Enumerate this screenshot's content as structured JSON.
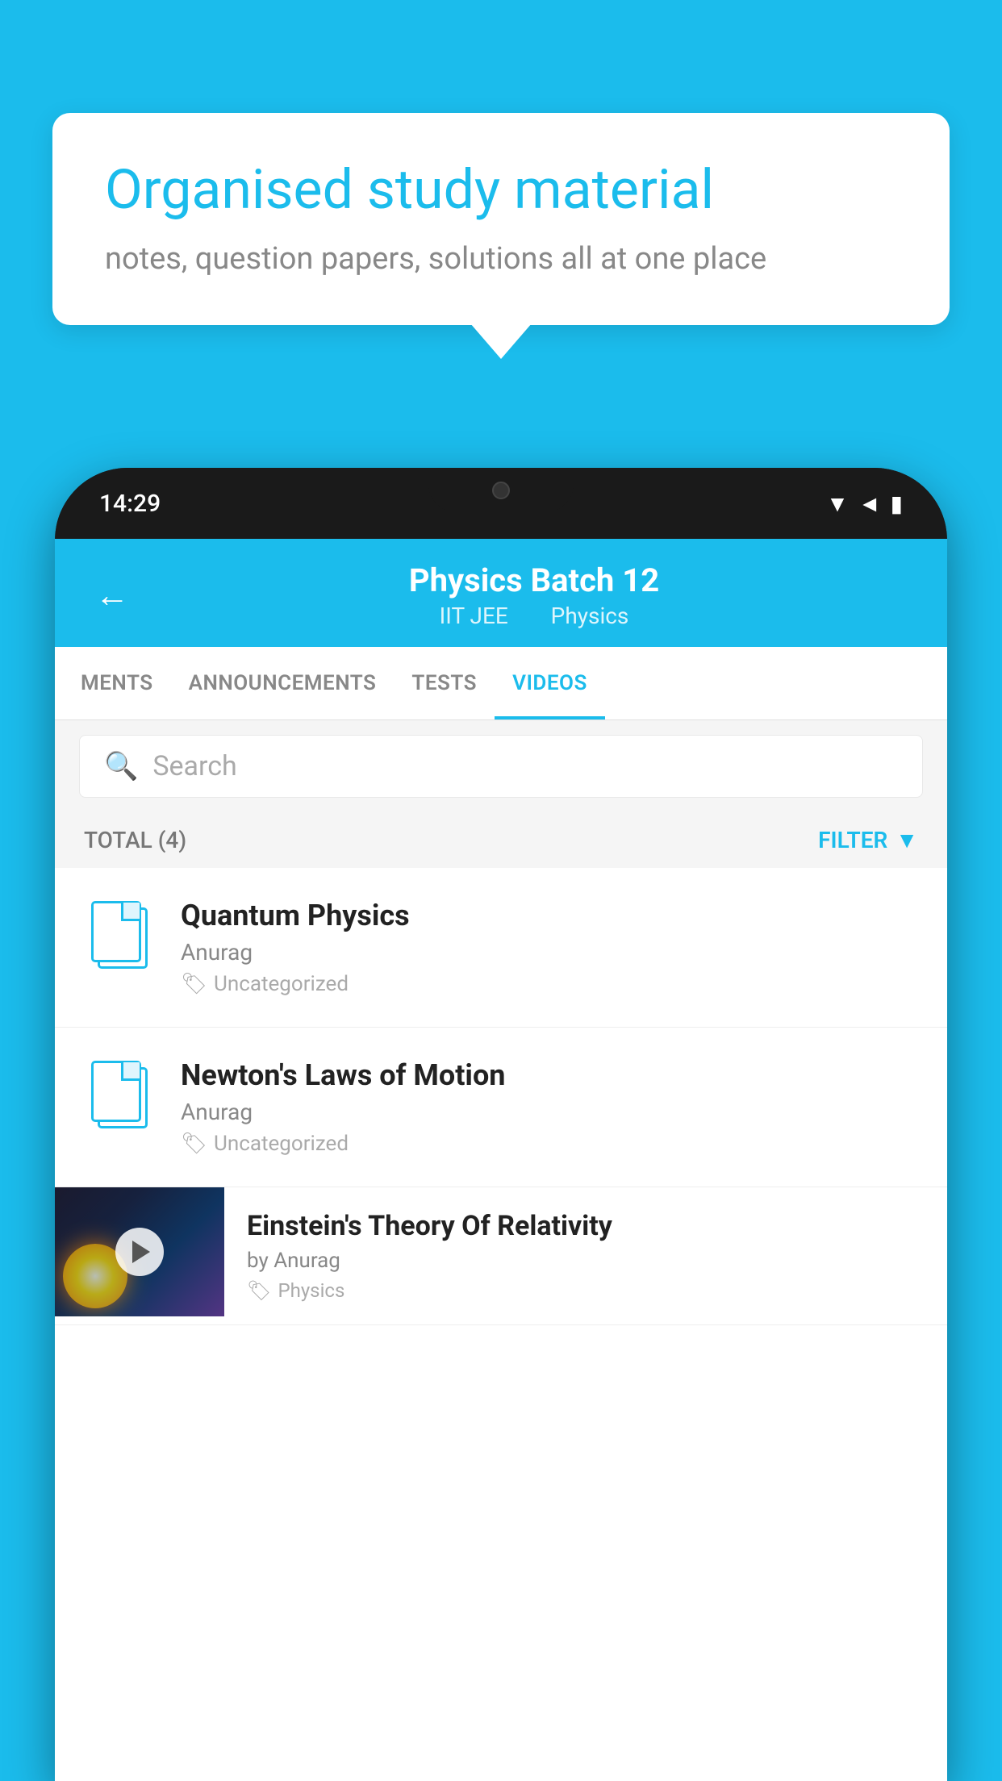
{
  "background_color": "#1BBCEC",
  "speech_bubble": {
    "headline": "Organised study material",
    "subtext": "notes, question papers, solutions all at one place"
  },
  "phone": {
    "status_bar": {
      "time": "14:29",
      "icons": [
        "wifi",
        "signal",
        "battery"
      ]
    },
    "header": {
      "title": "Physics Batch 12",
      "subtitle_parts": [
        "IIT JEE",
        "Physics"
      ],
      "back_label": "←"
    },
    "tabs": [
      {
        "label": "MENTS",
        "active": false
      },
      {
        "label": "ANNOUNCEMENTS",
        "active": false
      },
      {
        "label": "TESTS",
        "active": false
      },
      {
        "label": "VIDEOS",
        "active": true
      }
    ],
    "search": {
      "placeholder": "Search"
    },
    "filter_row": {
      "total_label": "TOTAL (4)",
      "filter_label": "FILTER"
    },
    "videos": [
      {
        "title": "Quantum Physics",
        "author": "Anurag",
        "tag": "Uncategorized",
        "type": "doc"
      },
      {
        "title": "Newton's Laws of Motion",
        "author": "Anurag",
        "tag": "Uncategorized",
        "type": "doc"
      },
      {
        "title": "Einstein's Theory Of Relativity",
        "author": "by Anurag",
        "tag": "Physics",
        "type": "video"
      }
    ]
  }
}
